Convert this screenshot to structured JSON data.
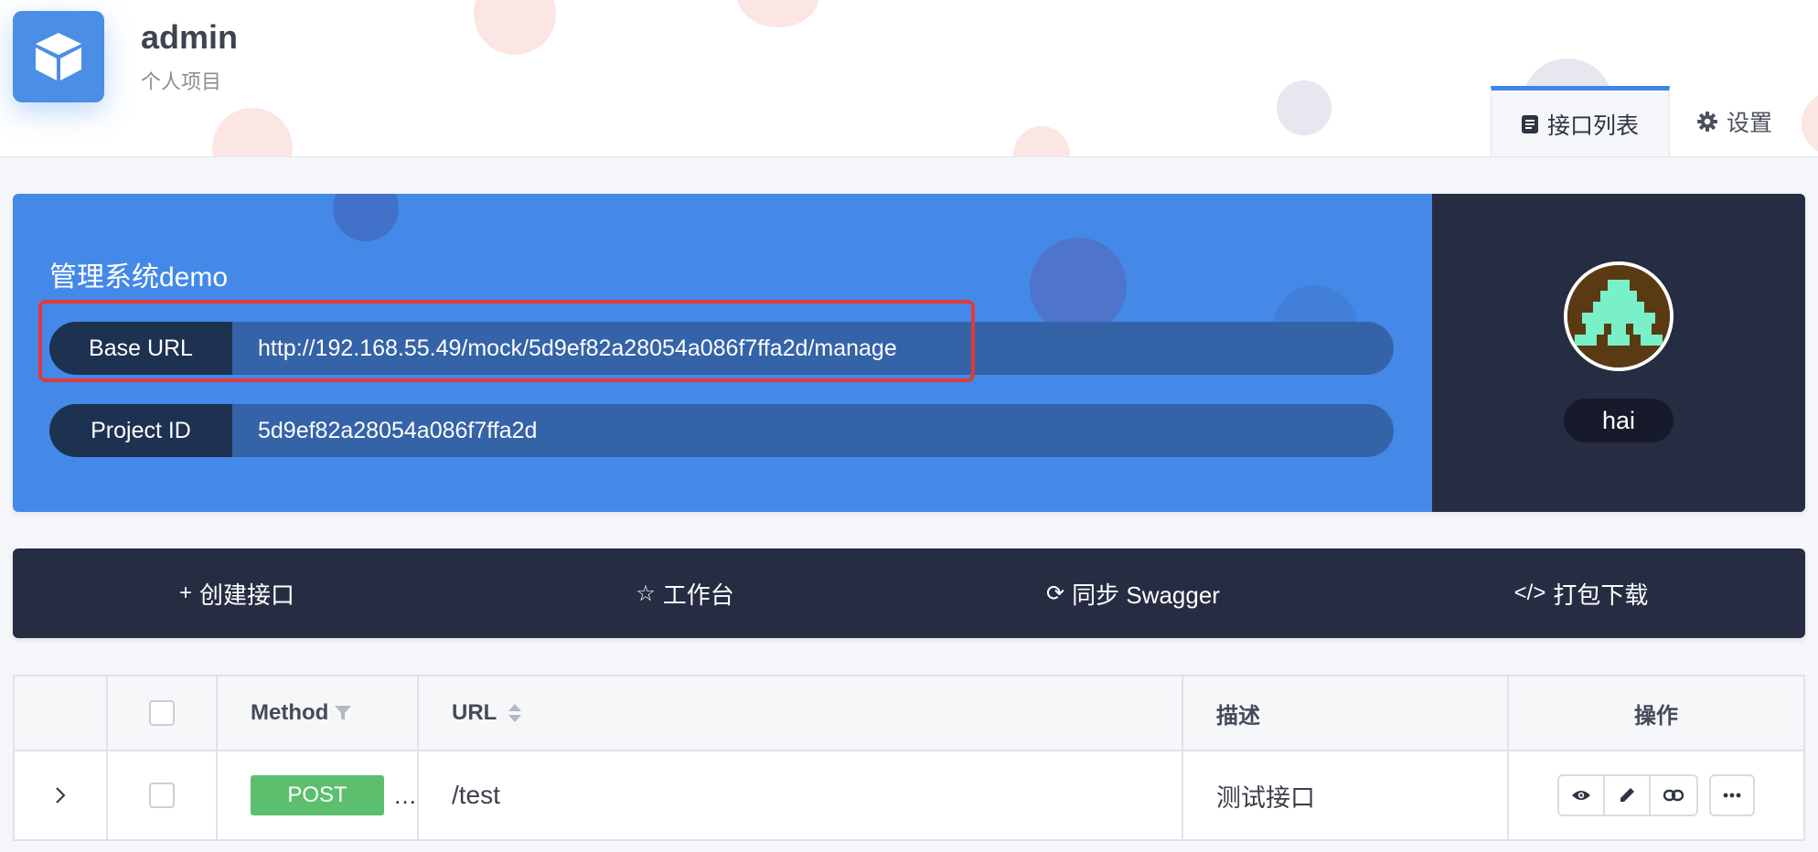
{
  "project": {
    "name": "admin",
    "type": "个人项目"
  },
  "tabs": {
    "api_list": "接口列表",
    "settings": "设置"
  },
  "banner": {
    "title": "管理系统demo",
    "base_url_label": "Base URL",
    "base_url_value": "http://192.168.55.49/mock/5d9ef82a28054a086f7ffa2d/manage",
    "project_id_label": "Project ID",
    "project_id_value": "5d9ef82a28054a086f7ffa2d"
  },
  "user": {
    "name": "hai"
  },
  "toolbar": {
    "create": "创建接口",
    "workbench": "工作台",
    "sync_swagger": "同步 Swagger",
    "download": "打包下载"
  },
  "table": {
    "headers": {
      "method": "Method",
      "url": "URL",
      "desc": "描述",
      "ops": "操作"
    },
    "rows": [
      {
        "method": "POST",
        "url": "/test",
        "desc": "测试接口"
      }
    ]
  },
  "colors": {
    "accent": "#4489e8",
    "dark": "#262c42",
    "post": "#5cbf6e",
    "highlight": "#e03a3a"
  }
}
